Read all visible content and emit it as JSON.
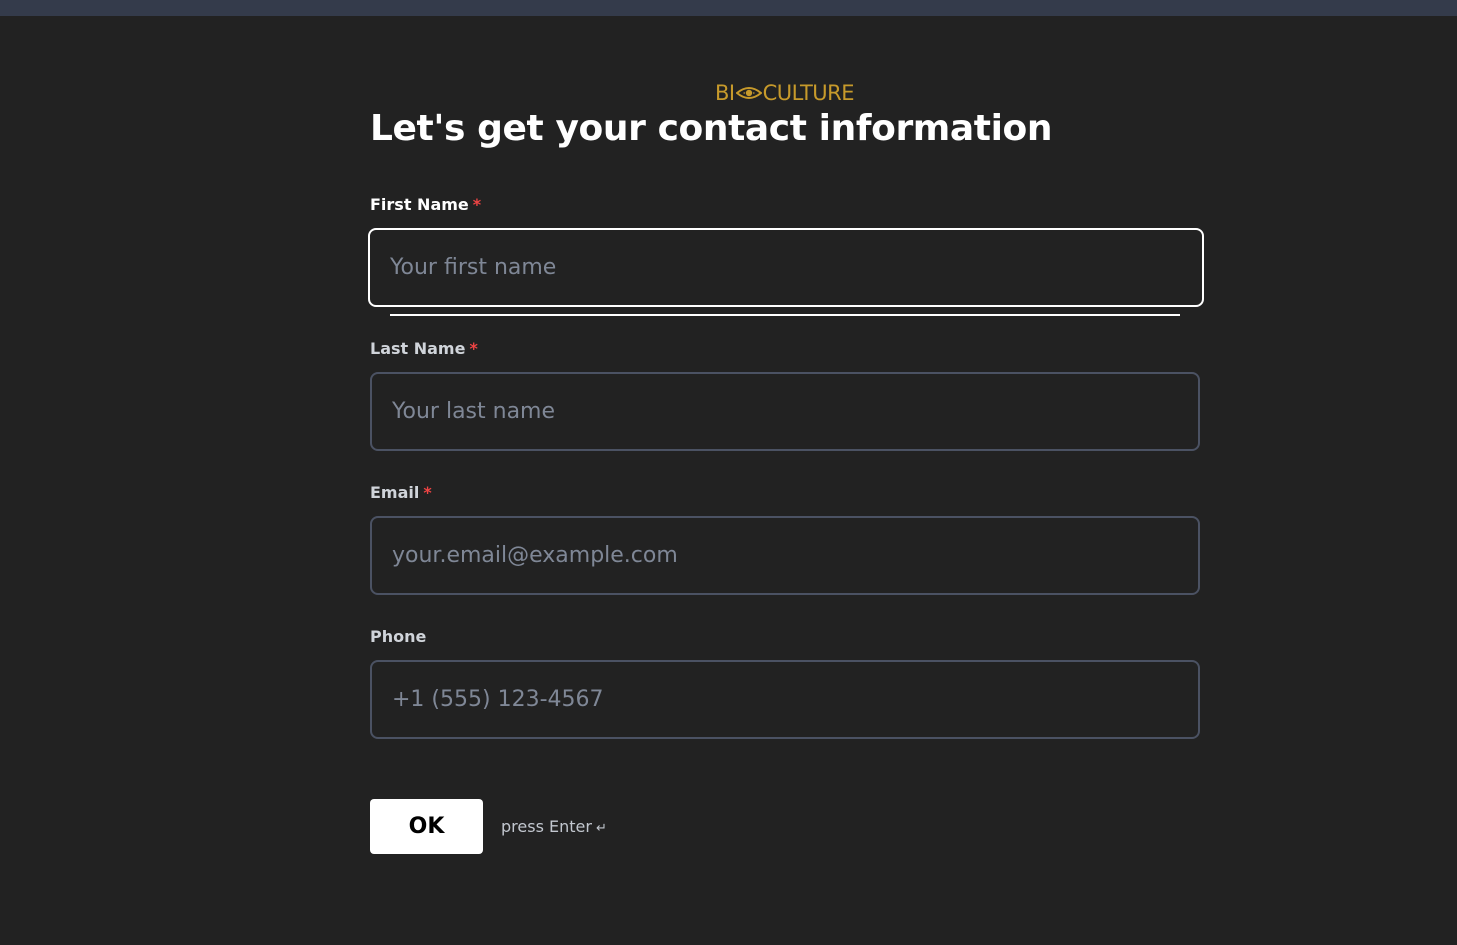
{
  "brand": {
    "logo_left": "BI",
    "logo_right": "CULTURE",
    "accent_color": "#c79a2b"
  },
  "page": {
    "title": "Let's get your contact information"
  },
  "form": {
    "first_name": {
      "label": "First Name",
      "required_mark": "*",
      "placeholder": "Your first name",
      "value": ""
    },
    "last_name": {
      "label": "Last Name",
      "required_mark": "*",
      "placeholder": "Your last name",
      "value": ""
    },
    "email": {
      "label": "Email",
      "required_mark": "*",
      "placeholder": "your.email@example.com",
      "value": ""
    },
    "phone": {
      "label": "Phone",
      "placeholder": "+1 (555) 123-4567",
      "value": ""
    }
  },
  "actions": {
    "ok_label": "OK",
    "hint_text": "press Enter",
    "hint_icon": "↵"
  },
  "colors": {
    "background": "#222222",
    "topbar": "#343b4b",
    "required": "#ef4444",
    "input_border": "#4b5263",
    "input_border_focused": "#ffffff"
  }
}
